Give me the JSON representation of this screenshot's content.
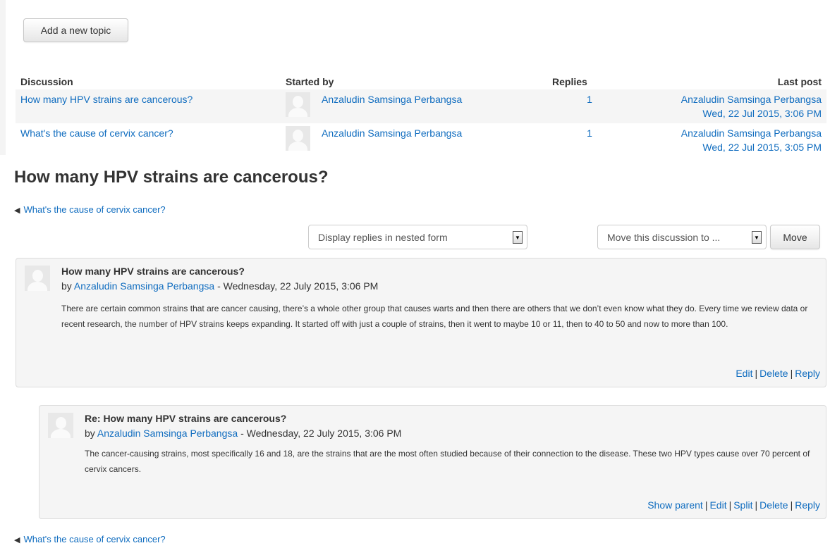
{
  "toolbar": {
    "add_topic_label": "Add a new topic"
  },
  "discussion_list": {
    "headers": {
      "discussion": "Discussion",
      "started_by": "Started by",
      "replies": "Replies",
      "last_post": "Last post"
    },
    "rows": [
      {
        "topic": "How many HPV strains are cancerous?",
        "started_by": "Anzaludin Samsinga Perbangsa",
        "replies": "1",
        "last_post_author": "Anzaludin Samsinga Perbangsa",
        "last_post_date": "Wed, 22 Jul 2015, 3:06 PM"
      },
      {
        "topic": "What's the cause of cervix cancer?",
        "started_by": "Anzaludin Samsinga Perbangsa",
        "replies": "1",
        "last_post_author": "Anzaludin Samsinga Perbangsa",
        "last_post_date": "Wed, 22 Jul 2015, 3:05 PM"
      }
    ]
  },
  "discussion": {
    "title": "How many HPV strains are cancerous?",
    "prev_link": "What's the cause of cervix cancer?",
    "display_mode": "Display replies in nested form",
    "move_placeholder": "Move this discussion to ...",
    "move_button": "Move"
  },
  "posts": [
    {
      "subject": "How many HPV strains are cancerous?",
      "by_prefix": "by",
      "author": "Anzaludin Samsinga Perbangsa",
      "date_suffix": "- Wednesday, 22 July 2015, 3:06 PM",
      "content": "There are certain common strains that are cancer causing, there’s a whole other group that causes warts and then there are others that we don’t even know what they do. Every time we review data or recent research, the number of HPV strains keeps expanding. It started off with just a couple of strains, then it went to maybe 10 or 11, then to 40 to 50 and now to more than 100.",
      "commands": [
        "Edit",
        "Delete",
        "Reply"
      ]
    },
    {
      "subject": "Re: How many HPV strains are cancerous?",
      "by_prefix": "by",
      "author": "Anzaludin Samsinga Perbangsa",
      "date_suffix": "- Wednesday, 22 July 2015, 3:06 PM",
      "content": "The cancer-causing strains, most specifically 16 and 18, are the strains that are the most often studied because of their connection to the disease. These two HPV types cause over 70 percent of cervix cancers.",
      "commands": [
        "Show parent",
        "Edit",
        "Split",
        "Delete",
        "Reply"
      ]
    }
  ],
  "icons": {
    "prev": "triangle-left-icon",
    "dropdown": "chevron-down-icon",
    "avatar": "default-user-avatar-icon"
  },
  "colors": {
    "link": "#0f6cbf",
    "post_bg": "#f5f5f5",
    "row_bg": "#f5f5f5"
  }
}
